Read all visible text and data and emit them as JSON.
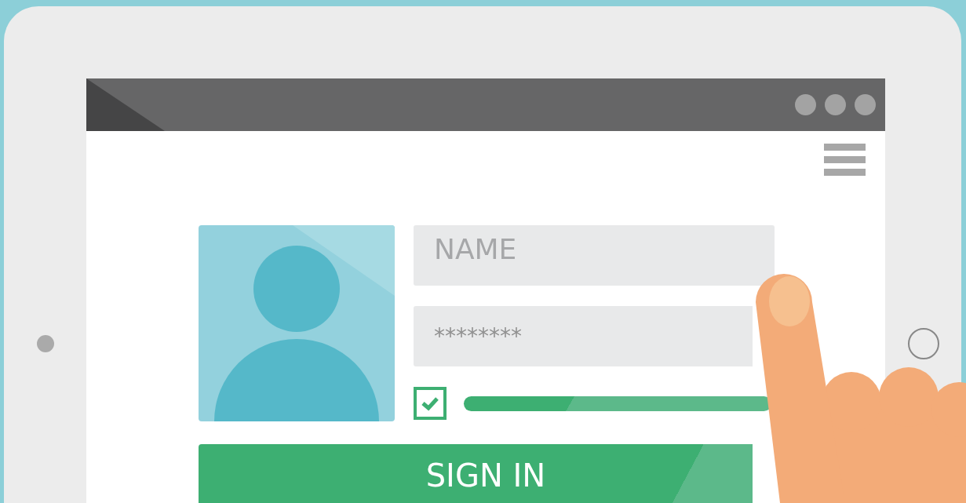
{
  "login_form": {
    "name_field": {
      "placeholder": "NAME"
    },
    "password_field": {
      "value": "********"
    },
    "remember_checkbox": {
      "checked": true
    },
    "sign_in_button": {
      "label": "SIGN IN"
    }
  }
}
